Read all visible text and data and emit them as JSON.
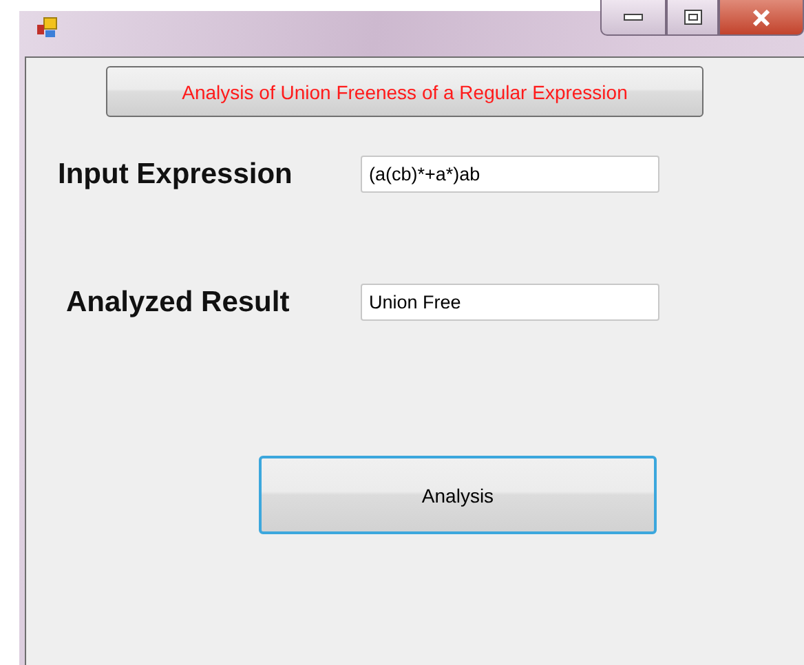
{
  "header_button": {
    "label": "Analysis of Union Freeness of a Regular Expression"
  },
  "fields": [
    {
      "label": "Input Expression",
      "value": "(a(cb)*+a*)ab"
    },
    {
      "label": "Analyzed Result",
      "value": "Union Free"
    }
  ],
  "action_button": {
    "label": "Analysis",
    "focused": true
  }
}
